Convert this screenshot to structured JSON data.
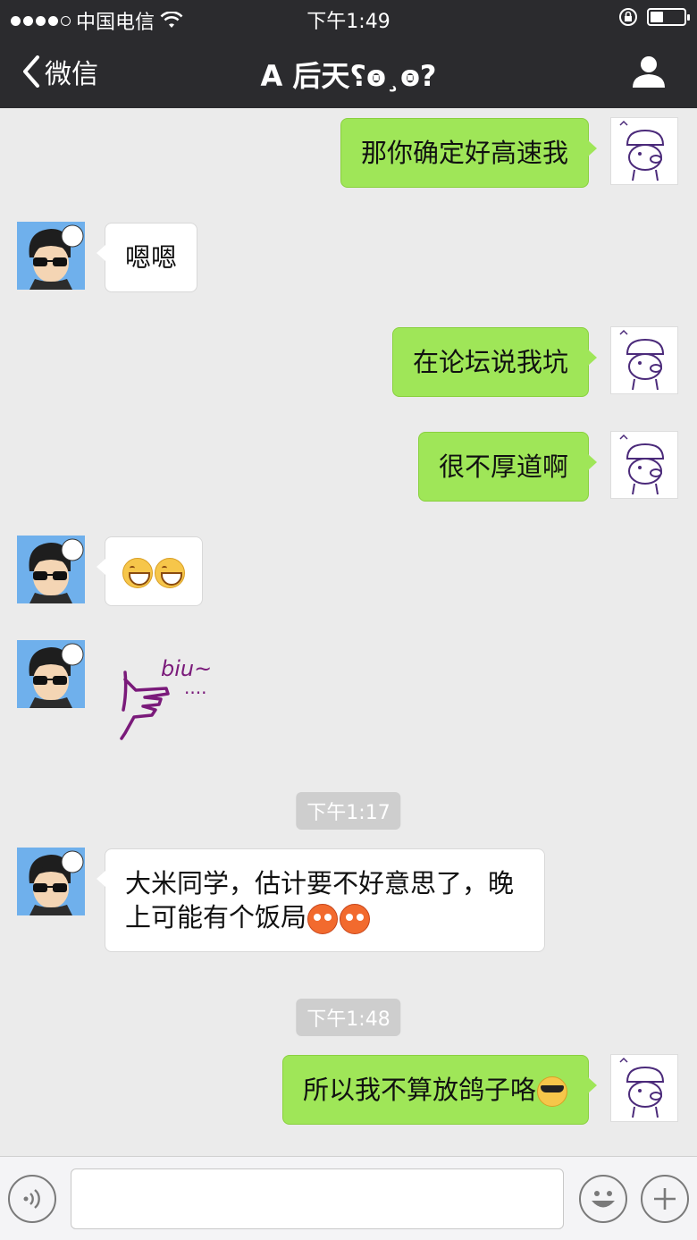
{
  "status": {
    "carrier": "中国电信",
    "time": "下午1:49"
  },
  "nav": {
    "back_label": "微信",
    "title": "A 后天⸮ꙩ¸ꙩ?"
  },
  "messages": [
    {
      "dir": "out",
      "text": "那你确定好高速我"
    },
    {
      "dir": "in",
      "text": "嗯嗯"
    },
    {
      "dir": "out",
      "text": "在论坛说我坑"
    },
    {
      "dir": "out",
      "text": "很不厚道啊"
    },
    {
      "dir": "in",
      "emoji": [
        "grin-emoji",
        "grin-emoji"
      ]
    },
    {
      "dir": "in",
      "sticker": "biu~ ....",
      "sticker_name": "finger-gun-sticker"
    },
    {
      "time": "下午1:17"
    },
    {
      "dir": "in",
      "text_line1": "大米同学，估计要不好意思了，晚",
      "text_line2": "上可能有个饭局",
      "emoji": [
        "blush-emoji",
        "blush-emoji"
      ]
    },
    {
      "time": "下午1:48"
    },
    {
      "dir": "out",
      "text": "所以我不算放鸽子咯",
      "emoji": [
        "cool-emoji"
      ]
    }
  ],
  "input": {
    "value": "",
    "placeholder": ""
  },
  "colors": {
    "header": "#2b2b2e",
    "chat_bg": "#ebebeb",
    "out_bubble": "#9fe658",
    "in_bubble": "#ffffff"
  }
}
